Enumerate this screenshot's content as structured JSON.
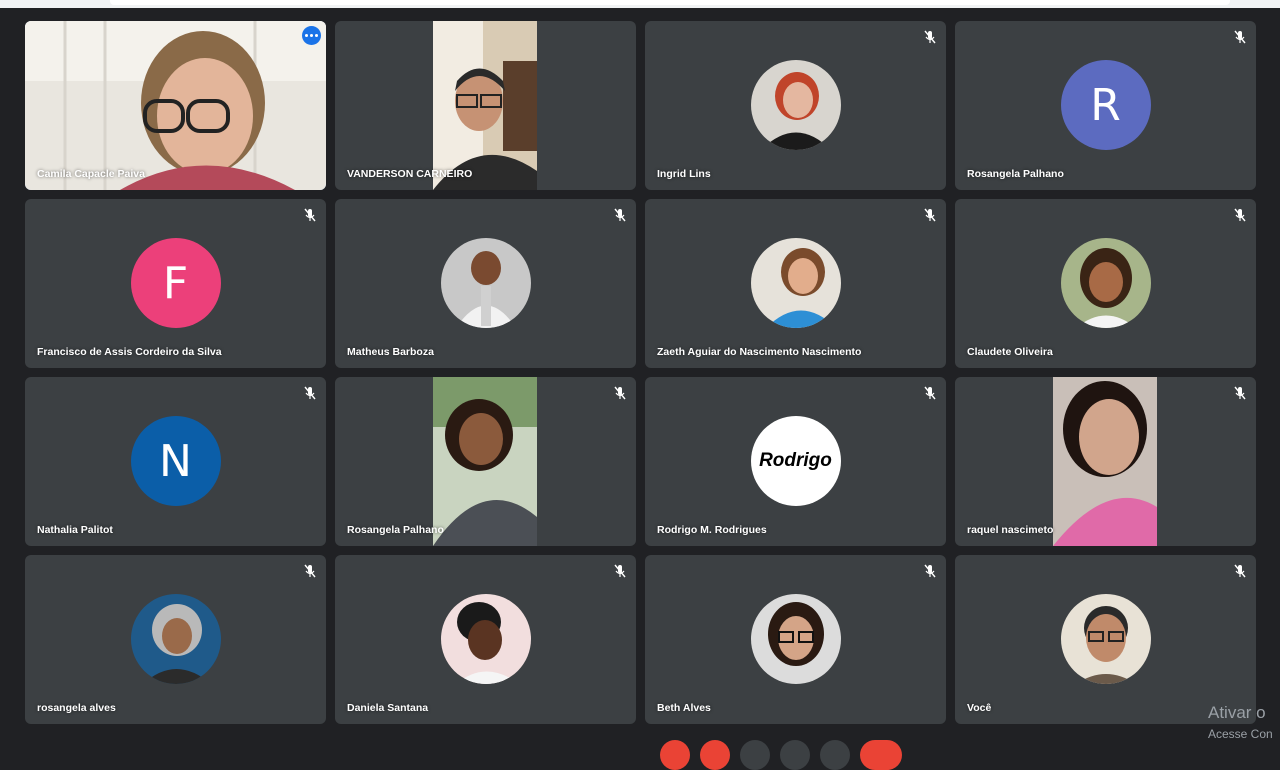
{
  "accent_color": "#1a73e8",
  "tiles": [
    {
      "name": "Camila Capacle Paiva",
      "kind": "video",
      "speaking": true,
      "menu": true
    },
    {
      "name": "VANDERSON CARNEIRO",
      "kind": "video"
    },
    {
      "name": "Ingrid Lins",
      "kind": "photo",
      "muted": true
    },
    {
      "name": "Rosangela Palhano",
      "kind": "letter",
      "letter": "R",
      "color": "#5c6bc0",
      "muted": true
    },
    {
      "name": "Francisco de Assis Cordeiro da Silva",
      "kind": "letter",
      "letter": "F",
      "color": "#ec407a",
      "muted": true
    },
    {
      "name": "Matheus Barboza",
      "kind": "photo",
      "muted": true
    },
    {
      "name": "Zaeth Aguiar do Nascimento Nascimento",
      "kind": "photo",
      "muted": true
    },
    {
      "name": "Claudete Oliveira",
      "kind": "photo",
      "muted": true
    },
    {
      "name": "Nathalia Palitot",
      "kind": "letter",
      "letter": "N",
      "color": "#0b5ea8",
      "muted": true
    },
    {
      "name": "Rosangela Palhano",
      "kind": "video",
      "muted": true
    },
    {
      "name": "Rodrigo M. Rodrigues",
      "kind": "logo",
      "logo_text": "Rodrigo",
      "muted": true
    },
    {
      "name": "raquel nascimeto",
      "kind": "video",
      "muted": true
    },
    {
      "name": "rosangela alves",
      "kind": "photo",
      "muted": true
    },
    {
      "name": "Daniela Santana",
      "kind": "photo",
      "muted": true
    },
    {
      "name": "Beth Alves",
      "kind": "photo",
      "muted": true
    },
    {
      "name": "Você",
      "kind": "photo",
      "muted": true
    }
  ],
  "windows_watermark": {
    "line1": "Ativar o",
    "line2": "Acesse Con"
  }
}
